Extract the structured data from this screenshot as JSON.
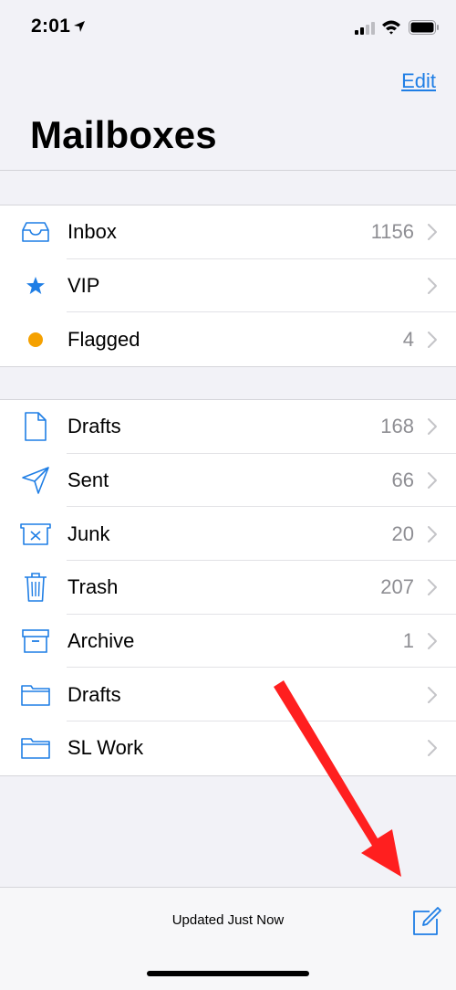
{
  "status_bar": {
    "time": "2:01"
  },
  "nav": {
    "edit_label": "Edit",
    "title": "Mailboxes"
  },
  "groups": [
    {
      "rows": [
        {
          "icon": "inbox-icon",
          "label": "Inbox",
          "count": "1156"
        },
        {
          "icon": "star-icon",
          "label": "VIP",
          "count": ""
        },
        {
          "icon": "flag-dot-icon",
          "label": "Flagged",
          "count": "4"
        }
      ]
    },
    {
      "rows": [
        {
          "icon": "document-icon",
          "label": "Drafts",
          "count": "168"
        },
        {
          "icon": "paper-plane-icon",
          "label": "Sent",
          "count": "66"
        },
        {
          "icon": "junk-tray-icon",
          "label": "Junk",
          "count": "20"
        },
        {
          "icon": "trash-icon",
          "label": "Trash",
          "count": "207"
        },
        {
          "icon": "archive-box-icon",
          "label": "Archive",
          "count": "1"
        },
        {
          "icon": "folder-icon",
          "label": "Drafts",
          "count": ""
        },
        {
          "icon": "folder-icon",
          "label": "SL Work",
          "count": ""
        }
      ]
    }
  ],
  "toolbar": {
    "status_text": "Updated Just Now",
    "compose_icon": "compose-icon"
  },
  "colors": {
    "accent": "#1f7ee5",
    "flag": "#f5a100",
    "annotation": "#ff1f1f",
    "count_gray": "#8e8e93"
  }
}
